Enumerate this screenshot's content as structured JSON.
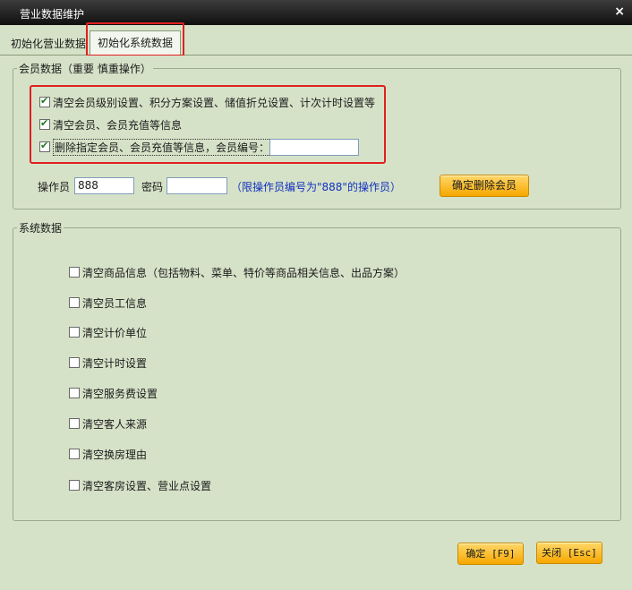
{
  "window": {
    "title": "营业数据维护",
    "close_glyph": "×"
  },
  "tabs": [
    {
      "label": "初始化营业数据"
    },
    {
      "label": "初始化系统数据"
    }
  ],
  "member_group": {
    "legend": "会员数据（重要 慎重操作）",
    "options": [
      {
        "label": "清空会员级别设置、积分方案设置、储值折兑设置、计次计时设置等",
        "checked": true
      },
      {
        "label": "清空会员、会员充值等信息",
        "checked": true
      },
      {
        "label": "删除指定会员、会员充值等信息，会员编号：",
        "checked": true
      }
    ],
    "member_no_value": "",
    "operator_label": "操作员",
    "operator_value": "888",
    "password_label": "密码",
    "password_value": "",
    "hint": "（限操作员编号为\"888\"的操作员）",
    "delete_button": "确定删除会员"
  },
  "system_group": {
    "legend": "系统数据",
    "options": [
      {
        "label": "清空商品信息（包括物料、菜单、特价等商品相关信息、出品方案）",
        "checked": false
      },
      {
        "label": "清空员工信息",
        "checked": false
      },
      {
        "label": "清空计价单位",
        "checked": false
      },
      {
        "label": "清空计时设置",
        "checked": false
      },
      {
        "label": "清空服务费设置",
        "checked": false
      },
      {
        "label": "清空客人来源",
        "checked": false
      },
      {
        "label": "清空换房理由",
        "checked": false
      },
      {
        "label": "清空客房设置、营业点设置",
        "checked": false
      }
    ]
  },
  "footer": {
    "ok_button": "确定 [F9]",
    "close_button": "关闭 [Esc]"
  },
  "colors": {
    "background": "#d6e2c8",
    "titlebar": "#1a1a1a",
    "highlight": "#e02020",
    "button": "#f6a700",
    "hint_text": "#1030c0"
  },
  "icons": {
    "close": "close-icon",
    "checkbox": "checkbox-icon"
  }
}
